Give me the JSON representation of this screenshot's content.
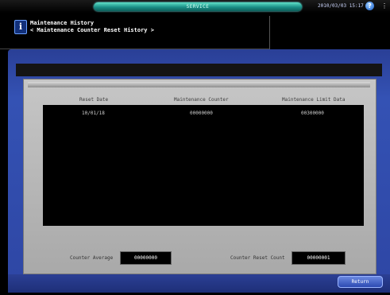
{
  "topbar": {
    "service_label": "SERVICE",
    "datetime": "2010/03/03 15:17",
    "help_icon": "help-icon",
    "edge_icon": "status-icon"
  },
  "header": {
    "title_line1": "Maintenance History",
    "title_line2": "< Maintenance Counter Reset History >",
    "info_icon": "info-icon"
  },
  "table": {
    "columns": [
      "Reset Date",
      "Maintenance Counter",
      "Maintenance Limit Data"
    ],
    "rows": [
      [
        "10/01/18",
        "00000000",
        "00300000"
      ]
    ]
  },
  "footer": {
    "counter_average_label": "Counter Average",
    "counter_average_value": "00000000",
    "reset_count_label": "Counter Reset Count",
    "reset_count_value": "00000001"
  },
  "actions": {
    "return_label": "Return"
  },
  "colors": {
    "accent_blue": "#3452b4",
    "service_teal": "#1a8f86",
    "panel_gray": "#b8b8b8"
  }
}
